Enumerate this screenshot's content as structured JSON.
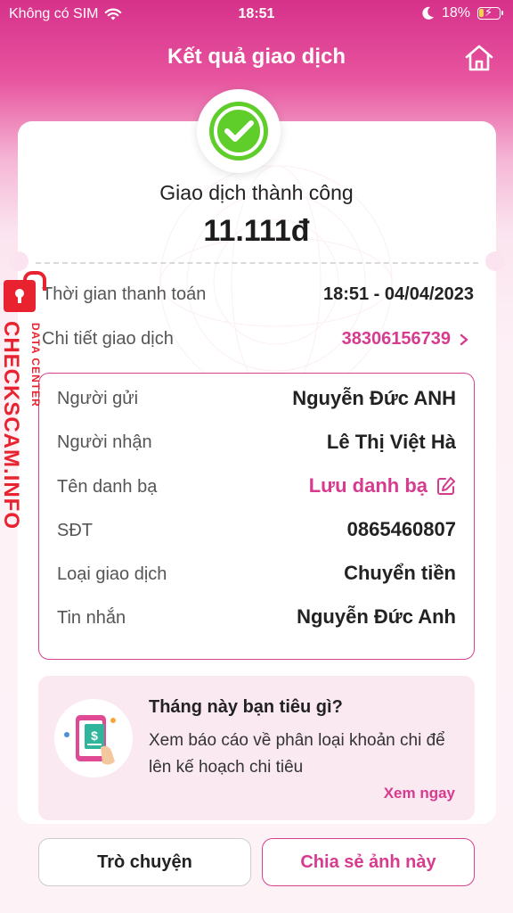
{
  "status_bar": {
    "carrier": "Không có SIM",
    "time": "18:51",
    "battery": "18%",
    "icons": [
      "wifi-icon",
      "moon-icon",
      "battery-charging-icon"
    ]
  },
  "header": {
    "title": "Kết quả giao dịch",
    "home_icon": "home-icon"
  },
  "result": {
    "status_text": "Giao dịch thành công",
    "amount": "11.111đ",
    "status_icon": "check-circle-icon"
  },
  "summary": {
    "payment_time_label": "Thời gian thanh toán",
    "payment_time_value": "18:51 - 04/04/2023",
    "detail_label": "Chi tiết giao dịch",
    "detail_value": "38306156739"
  },
  "details": {
    "rows": [
      {
        "label": "Người gửi",
        "value": "Nguyễn Đức ANH"
      },
      {
        "label": "Người nhận",
        "value": "Lê Thị Việt Hà"
      },
      {
        "label": "Tên danh bạ",
        "value": "Lưu danh bạ"
      },
      {
        "label": "SĐT",
        "value": "0865460807"
      },
      {
        "label": "Loại giao dịch",
        "value": "Chuyển tiền"
      },
      {
        "label": "Tin nhắn",
        "value": "Nguyễn Đức Anh"
      }
    ]
  },
  "promo": {
    "title": "Tháng này bạn tiêu gì?",
    "description": "Xem báo cáo về phân loại khoản chi để lên kế hoạch chi tiêu",
    "link": "Xem ngay"
  },
  "actions": {
    "chat": "Trò chuyện",
    "share": "Chia sẻ ảnh này"
  },
  "watermark": {
    "main": "CHECKSCAM.INFO",
    "sub": "DATA CENTER"
  },
  "colors": {
    "brand_pink": "#d63b8f",
    "success_green": "#4cbb17",
    "watermark_red": "#e8232f"
  }
}
